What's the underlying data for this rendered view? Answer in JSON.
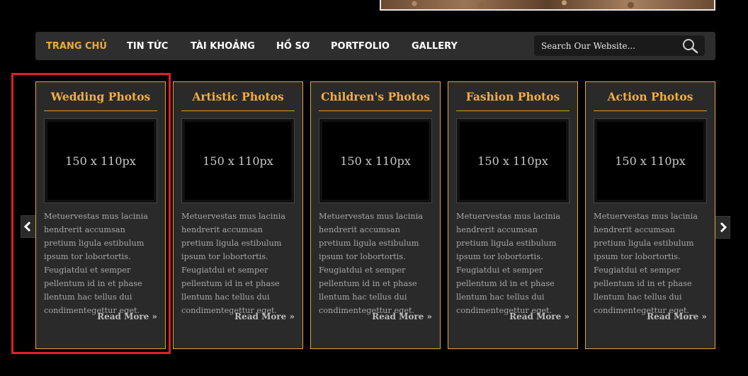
{
  "nav": {
    "items": [
      {
        "label": "TRANG CHỦ",
        "active": true
      },
      {
        "label": "TIN TỨC"
      },
      {
        "label": "TÀI KHOẢNG"
      },
      {
        "label": "HỒ SƠ"
      },
      {
        "label": "PORTFOLIO"
      },
      {
        "label": "GALLERY"
      }
    ],
    "search_placeholder": "Search Our Website..."
  },
  "carousel": {
    "prev_icon": "chevron-left-icon",
    "next_icon": "chevron-right-icon",
    "cards": [
      {
        "title": "Wedding Photos",
        "thumb_label": "150 x 110px",
        "text": "Metuervestas mus lacinia hendrerit accumsan pretium ligula estibulum ipsum tor lobortortis. Feugiatdui et semper pellentum id in et phase llentum hac tellus dui condimentegettur eget.",
        "read_more": "Read More »"
      },
      {
        "title": "Artistic Photos",
        "thumb_label": "150 x 110px",
        "text": "Metuervestas mus lacinia hendrerit accumsan pretium ligula estibulum ipsum tor lobortortis. Feugiatdui et semper pellentum id in et phase llentum hac tellus dui condimentegettur eget.",
        "read_more": "Read More »"
      },
      {
        "title": "Children's Photos",
        "thumb_label": "150 x 110px",
        "text": "Metuervestas mus lacinia hendrerit accumsan pretium ligula estibulum ipsum tor lobortortis. Feugiatdui et semper pellentum id in et phase llentum hac tellus dui condimentegettur eget.",
        "read_more": "Read More »"
      },
      {
        "title": "Fashion Photos",
        "thumb_label": "150 x 110px",
        "text": "Metuervestas mus lacinia hendrerit accumsan pretium ligula estibulum ipsum tor lobortortis. Feugiatdui et semper pellentum id in et phase llentum hac tellus dui condimentegettur eget.",
        "read_more": "Read More »"
      },
      {
        "title": "Action Photos",
        "thumb_label": "150 x 110px",
        "text": "Metuervestas mus lacinia hendrerit accumsan pretium ligula estibulum ipsum tor lobortortis. Feugiatdui et semper pellentum id in et phase llentum hac tellus dui condimentegettur eget.",
        "read_more": "Read More »"
      }
    ]
  },
  "colors": {
    "accent": "#f3ae3c",
    "card_border": "#e5a73a",
    "highlight": "#e31e24"
  }
}
